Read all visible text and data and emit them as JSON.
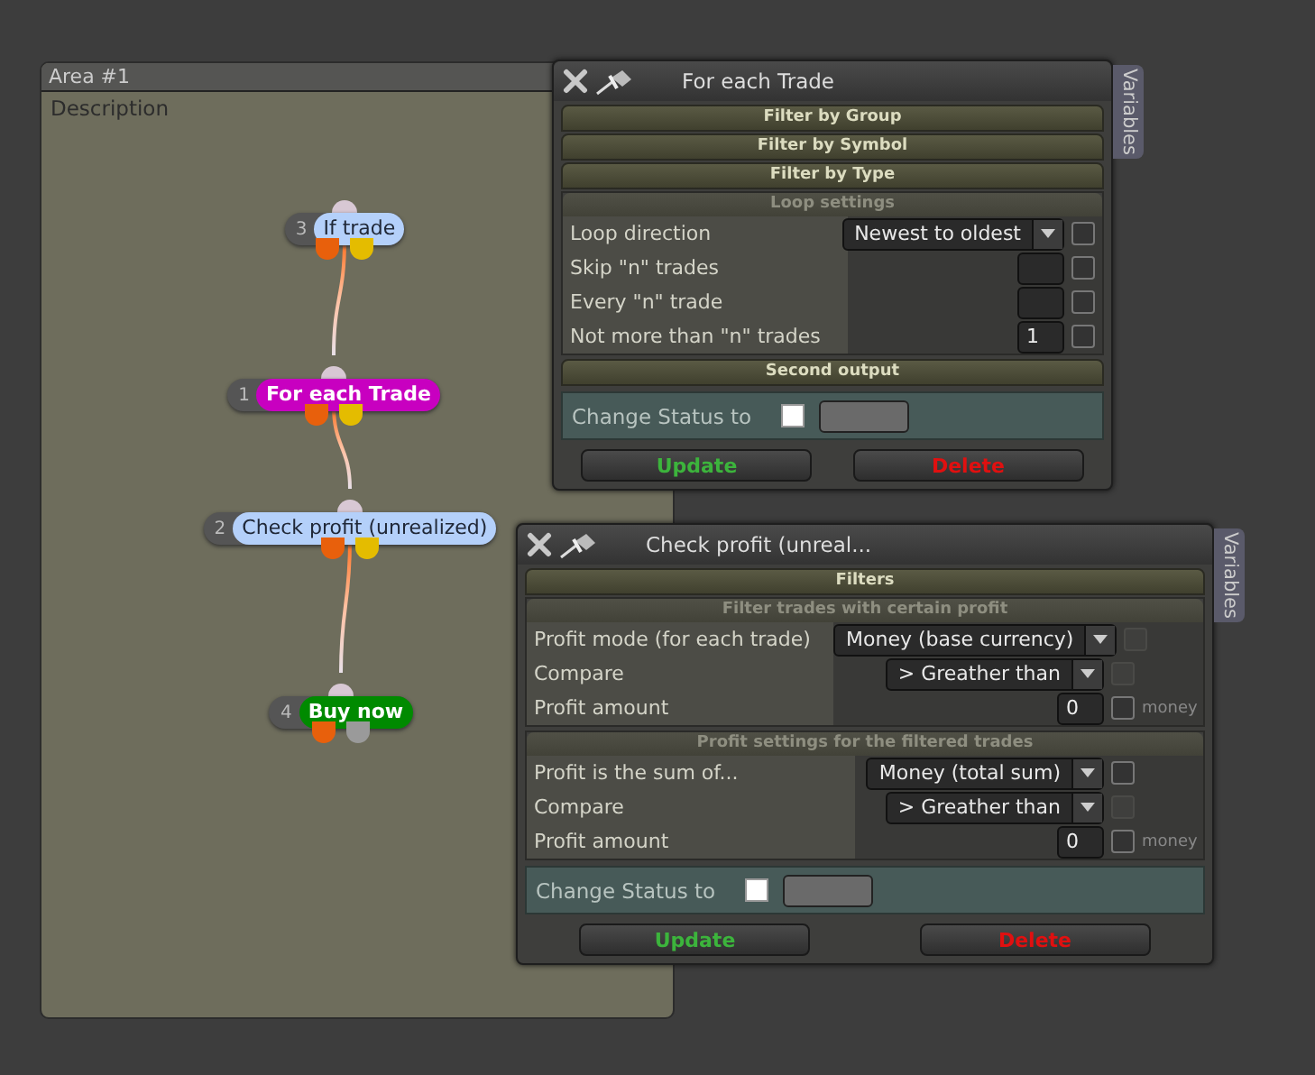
{
  "area": {
    "title": "Area #1",
    "description": "Description",
    "nodes": [
      {
        "number": "3",
        "label": "If trade",
        "color": "#b4d0fa",
        "ports": [
          {
            "color": "#e8600c"
          },
          {
            "color": "#e4bc00"
          }
        ]
      },
      {
        "number": "1",
        "label": "For each Trade",
        "color": "#c800c0",
        "ports": [
          {
            "color": "#e8600c"
          },
          {
            "color": "#e4bc00"
          }
        ]
      },
      {
        "number": "2",
        "label": "Check profit (unrealized)",
        "color": "#b4d0fa",
        "ports": [
          {
            "color": "#e8600c"
          },
          {
            "color": "#e4bc00"
          }
        ]
      },
      {
        "number": "4",
        "label": "Buy now",
        "color": "#008a00",
        "ports": [
          {
            "color": "#e8600c"
          },
          {
            "color": "#9a9a9a"
          }
        ]
      }
    ]
  },
  "dialogs": [
    {
      "title": "For each Trade",
      "side_tab": "Variables",
      "sections": [
        {
          "kind": "bar",
          "title": "Filter by Group"
        },
        {
          "kind": "bar",
          "title": "Filter by Symbol"
        },
        {
          "kind": "bar",
          "title": "Filter by Type"
        },
        {
          "kind": "group",
          "title": "Loop settings",
          "rows": [
            {
              "label": "Loop direction",
              "kind": "select",
              "value": "Newest to oldest",
              "checkbox_disabled": false
            },
            {
              "label": "Skip \"n\" trades",
              "kind": "number",
              "checkbox_disabled": false
            },
            {
              "label": "Every \"n\" trade",
              "kind": "number",
              "checkbox_disabled": false
            },
            {
              "label": "Not more than \"n\" trades",
              "kind": "number",
              "value": "1",
              "checkbox_disabled": false
            }
          ]
        },
        {
          "kind": "bar",
          "title": "Second output"
        }
      ],
      "change_status": {
        "label": "Change Status to",
        "checked": false
      },
      "buttons": [
        {
          "label": "Update",
          "kind": "update"
        },
        {
          "label": "Delete",
          "kind": "delete"
        }
      ]
    },
    {
      "title": "Check profit (unreal...",
      "side_tab": "Variables",
      "sections": [
        {
          "kind": "bar",
          "title": "Filters"
        },
        {
          "kind": "group",
          "title": "Filter trades with certain profit",
          "rows": [
            {
              "label": "Profit mode (for each trade)",
              "kind": "select",
              "value": "Money (base currency)",
              "checkbox_disabled": true
            },
            {
              "label": "Compare",
              "kind": "select",
              "value": "> Greather than",
              "checkbox_disabled": true
            },
            {
              "label": "Profit amount",
              "kind": "number",
              "value": "0",
              "checkbox_disabled": false,
              "unit": "money"
            }
          ]
        },
        {
          "kind": "group",
          "title": "Profit settings for the filtered trades",
          "rows": [
            {
              "label": "Profit is the sum of...",
              "kind": "select",
              "value": "Money (total sum)",
              "checkbox_disabled": false
            },
            {
              "label": "Compare",
              "kind": "select",
              "value": "> Greather than",
              "checkbox_disabled": true
            },
            {
              "label": "Profit amount",
              "kind": "number",
              "value": "0",
              "checkbox_disabled": false,
              "unit": "money"
            }
          ]
        }
      ],
      "change_status": {
        "label": "Change Status to",
        "checked": false
      },
      "buttons": [
        {
          "label": "Update",
          "kind": "update"
        },
        {
          "label": "Delete",
          "kind": "delete"
        }
      ]
    }
  ]
}
